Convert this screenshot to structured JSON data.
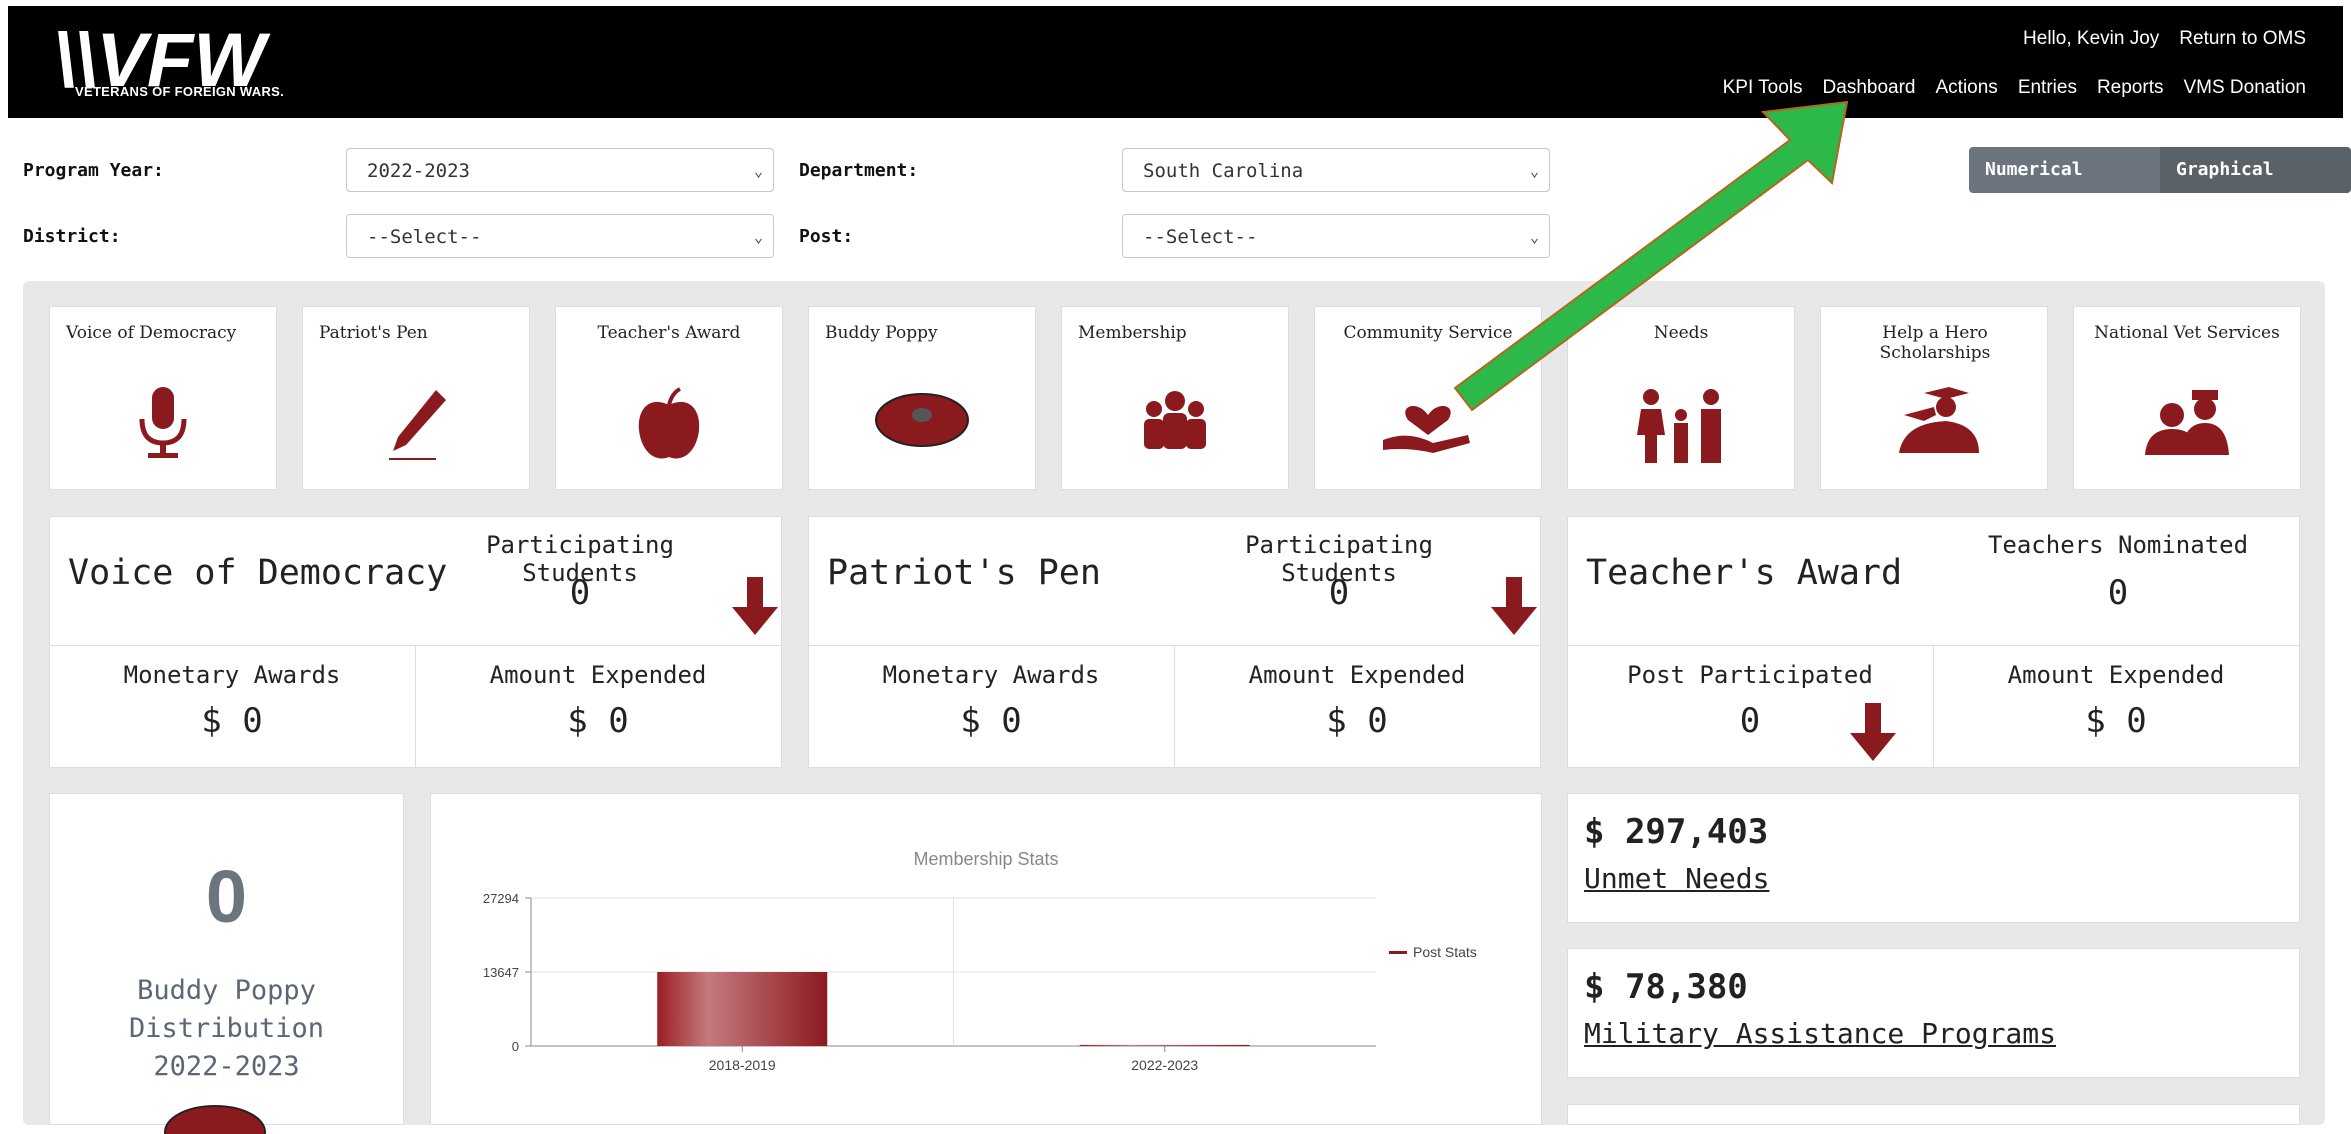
{
  "header": {
    "logo_text": "VFW",
    "logo_subtitle": "VETERANS OF FOREIGN WARS.",
    "greeting": "Hello, Kevin Joy",
    "return_link": "Return to OMS",
    "nav": [
      "KPI Tools",
      "Dashboard",
      "Actions",
      "Entries",
      "Reports",
      "VMS Donation"
    ]
  },
  "filters": {
    "program_year_label": "Program Year:",
    "program_year_value": "2022-2023",
    "department_label": "Department:",
    "department_value": "South Carolina",
    "district_label": "District:",
    "district_value": "--Select--",
    "post_label": "Post:",
    "post_value": "--Select--"
  },
  "view_toggle": {
    "numerical": "Numerical Stats",
    "graphical": "Graphical Stats"
  },
  "tiles": [
    {
      "label": "Voice of Democracy",
      "icon": "microphone-icon"
    },
    {
      "label": "Patriot's Pen",
      "icon": "pen-icon"
    },
    {
      "label": "Teacher's Award",
      "icon": "apple-icon"
    },
    {
      "label": "Buddy Poppy",
      "icon": "poppy-icon"
    },
    {
      "label": "Membership",
      "icon": "group-icon"
    },
    {
      "label": "Community Service",
      "icon": "heart-hand-icon"
    },
    {
      "label": "Needs",
      "icon": "family-icon"
    },
    {
      "label": "Help a Hero Scholarships",
      "icon": "saluting-graduate-icon"
    },
    {
      "label": "National Vet Services",
      "icon": "veterans-icon"
    }
  ],
  "stat_cards": [
    {
      "title": "Voice of Democracy",
      "top_label": "Participating Students",
      "top_value": "0",
      "left_label": "Monetary Awards",
      "left_value": "$ 0",
      "right_label": "Amount Expended",
      "right_value": "$ 0"
    },
    {
      "title": "Patriot's Pen",
      "top_label": "Participating Students",
      "top_value": "0",
      "left_label": "Monetary Awards",
      "left_value": "$ 0",
      "right_label": "Amount Expended",
      "right_value": "$ 0"
    },
    {
      "title": "Teacher's Award",
      "top_label": "Teachers Nominated",
      "top_value": "0",
      "left_label": "Post Participated",
      "left_value": "0",
      "right_label": "Amount Expended",
      "right_value": "$ 0"
    }
  ],
  "buddy_poppy": {
    "value": "0",
    "label_line1": "Buddy Poppy Distribution",
    "label_line2": "2022-2023"
  },
  "money_cards": [
    {
      "amount": "$ 297,403",
      "link": "Unmet Needs"
    },
    {
      "amount": "$ 78,380",
      "link": "Military Assistance Programs"
    }
  ],
  "colors": {
    "accent": "#8b1a1f",
    "arrow_green": "#2db84a",
    "toggle_gray": "#6c757d"
  },
  "chart_data": {
    "type": "bar",
    "title": "Membership Stats",
    "categories": [
      "2018-2019",
      "2022-2023"
    ],
    "series": [
      {
        "name": "Post Stats",
        "values": [
          13647,
          200
        ]
      }
    ],
    "ylim": [
      0,
      27294
    ],
    "yticks": [
      "0",
      "13647",
      "27294"
    ],
    "legend": "right",
    "grid": true
  }
}
